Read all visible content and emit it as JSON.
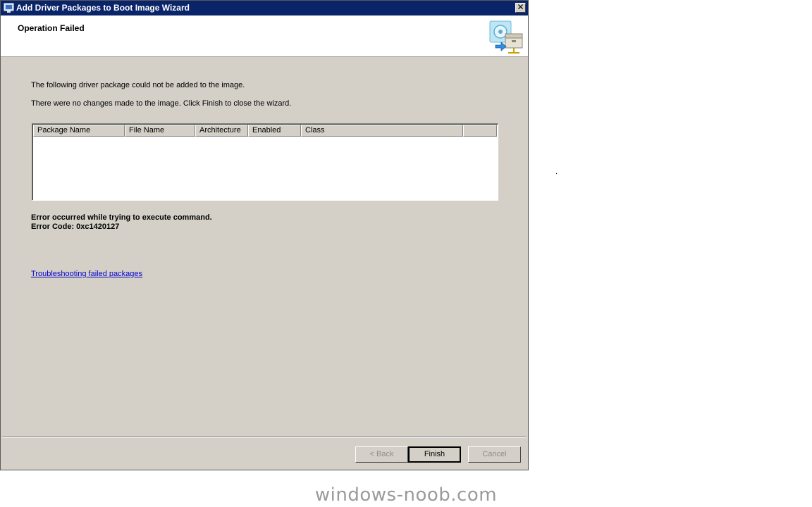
{
  "window": {
    "title": "Add Driver Packages to Boot Image Wizard",
    "close_glyph": "✕"
  },
  "header": {
    "title": "Operation Failed",
    "icon": "wizard-package-icon"
  },
  "messages": {
    "line1": "The following driver package could not be added to the image.",
    "line2": "There were no changes made to the image. Click Finish to close the wizard."
  },
  "table": {
    "columns": [
      "Package Name",
      "File Name",
      "Architecture",
      "Enabled",
      "Class",
      ""
    ],
    "rows": []
  },
  "error": {
    "line1": "Error occurred while trying to execute command.",
    "line2": "Error Code: 0xc1420127"
  },
  "link": {
    "text": "Troubleshooting failed packages"
  },
  "buttons": {
    "back": "< Back",
    "finish": "Finish",
    "cancel": "Cancel"
  },
  "stray_dot": ".",
  "watermark": "windows-noob.com"
}
